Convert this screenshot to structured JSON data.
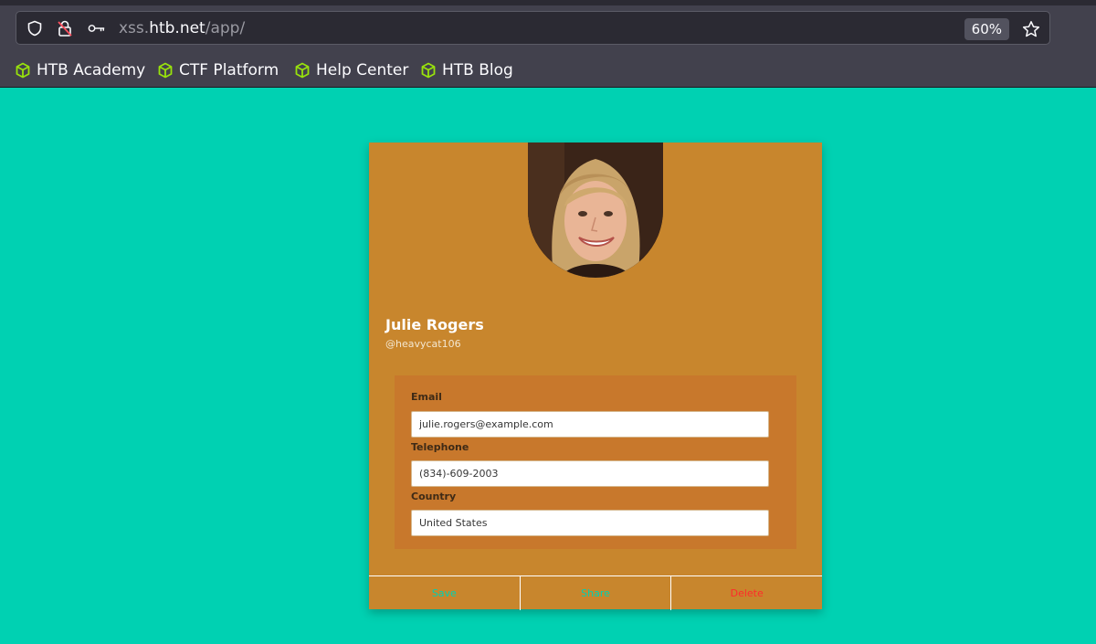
{
  "browser": {
    "url_scheme_host_prefix": "xss.",
    "url_host": "htb.net",
    "url_path": "/app/",
    "zoom": "60%",
    "bookmarks": [
      {
        "label": "HTB Academy",
        "icon": "cube-icon"
      },
      {
        "label": "CTF Platform",
        "icon": "cube-icon"
      },
      {
        "label": "Help Center",
        "icon": "cube-icon"
      },
      {
        "label": "HTB Blog",
        "icon": "cube-icon"
      }
    ]
  },
  "profile": {
    "name": "Julie Rogers",
    "handle": "@heavycat106",
    "fields": {
      "email_label": "Email",
      "email_value": "julie.rogers@example.com",
      "telephone_label": "Telephone",
      "telephone_value": "(834)-609-2003",
      "country_label": "Country",
      "country_value": "United States"
    },
    "actions": {
      "save": "Save",
      "share": "Share",
      "delete": "Delete"
    }
  },
  "colors": {
    "page_bg": "#00d1b2",
    "card_bg": "#c8862d",
    "form_bg": "#c8782c",
    "delete": "#ff2b2b",
    "bookmark_icon": "#98e20c"
  }
}
